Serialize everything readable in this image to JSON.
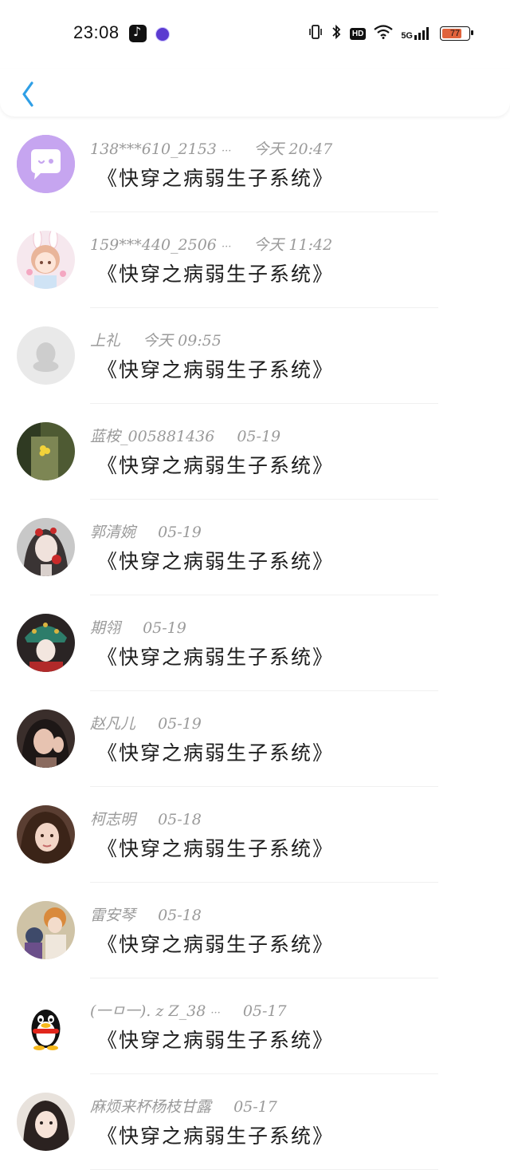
{
  "status_bar": {
    "time": "23:08",
    "battery": "77",
    "network": "5G",
    "hd_label": "HD",
    "icons": [
      "tiktok-icon",
      "app-circle-icon",
      "vibrate-icon",
      "bluetooth-icon",
      "hd-icon",
      "wifi-icon",
      "signal-icon",
      "battery-icon"
    ]
  },
  "header": {
    "back_icon": "chevron-left-icon"
  },
  "colors": {
    "accent": "#2f9fe6",
    "meta_text": "#9a9a9a",
    "message_text": "#1d1d1d"
  },
  "conversations": [
    {
      "name": "138***610_2153",
      "ellipsis": "···",
      "time": "今天 20:47",
      "message": "《快穿之病弱生子系统》",
      "avatar": "purple-chat-bubble-avatar"
    },
    {
      "name": "159***440_2506",
      "ellipsis": "···",
      "time": "今天 11:42",
      "message": "《快穿之病弱生子系统》",
      "avatar": "anime-bunny-girl-avatar"
    },
    {
      "name": "上礼",
      "ellipsis": "",
      "time": "今天 09:55",
      "message": "《快穿之病弱生子系统》",
      "avatar": "default-penguin-grey-avatar"
    },
    {
      "name": "蓝桉_005881436",
      "ellipsis": "",
      "time": "05-19",
      "message": "《快穿之病弱生子系统》",
      "avatar": "flower-green-avatar"
    },
    {
      "name": "郭清婉",
      "ellipsis": "",
      "time": "05-19",
      "message": "《快穿之病弱生子系统》",
      "avatar": "ancient-girl-red-flower-avatar"
    },
    {
      "name": "期翎",
      "ellipsis": "",
      "time": "05-19",
      "message": "《快穿之病弱生子系统》",
      "avatar": "opera-headdress-avatar"
    },
    {
      "name": "赵凡儿",
      "ellipsis": "",
      "time": "05-19",
      "message": "《快穿之病弱生子系统》",
      "avatar": "girl-photo-avatar"
    },
    {
      "name": "柯志明",
      "ellipsis": "",
      "time": "05-18",
      "message": "《快穿之病弱生子系统》",
      "avatar": "girl-selfie-avatar"
    },
    {
      "name": "雷安琴",
      "ellipsis": "",
      "time": "05-18",
      "message": "《快穿之病弱生子系统》",
      "avatar": "anime-boys-avatar"
    },
    {
      "name": "(一ㅁ一). z Z_38",
      "ellipsis": "···",
      "time": "05-17",
      "message": "《快穿之病弱生子系统》",
      "avatar": "qq-penguin-avatar"
    },
    {
      "name": "麻烦来杯杨枝甘露",
      "ellipsis": "",
      "time": "05-17",
      "message": "《快穿之病弱生子系统》",
      "avatar": "girl-portrait-avatar"
    }
  ]
}
